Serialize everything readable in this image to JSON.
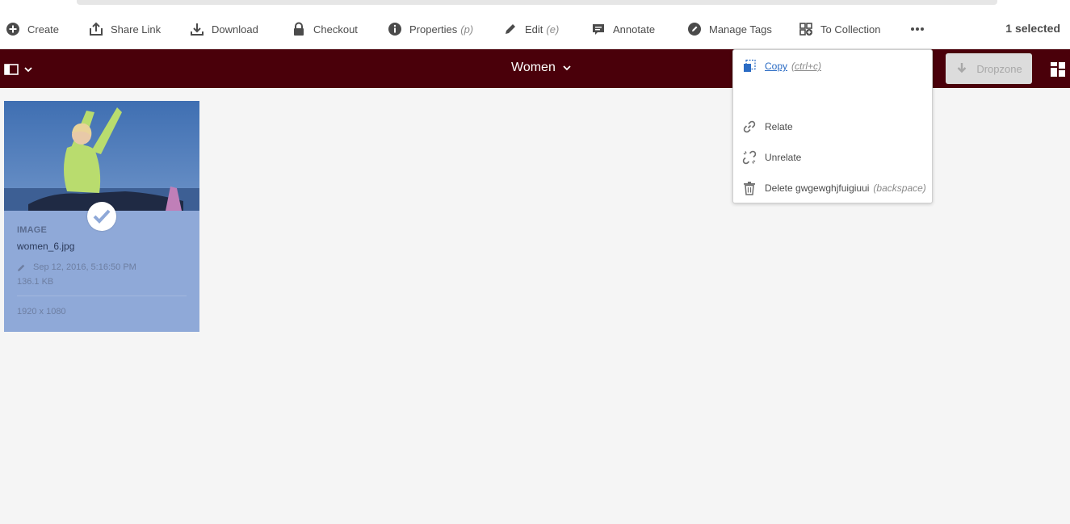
{
  "actionbar": {
    "actions": [
      {
        "label": "Create",
        "shortcut": "",
        "icon": "add-circle-icon"
      },
      {
        "label": "Share Link",
        "shortcut": "",
        "icon": "share-icon"
      },
      {
        "label": "Download",
        "shortcut": "",
        "icon": "download-icon"
      },
      {
        "label": "Checkout",
        "shortcut": "",
        "icon": "lock-icon"
      },
      {
        "label": "Properties",
        "shortcut": "(p)",
        "icon": "info-icon"
      },
      {
        "label": "Edit",
        "shortcut": "(e)",
        "icon": "pencil-icon"
      },
      {
        "label": "Annotate",
        "shortcut": "",
        "icon": "comment-icon"
      },
      {
        "label": "Manage Tags",
        "shortcut": "",
        "icon": "tag-icon"
      },
      {
        "label": "To Collection",
        "shortcut": "",
        "icon": "collection-add-icon"
      }
    ],
    "more_icon": "more-icon",
    "selection_count": "1 selected"
  },
  "header": {
    "folder_title": "Women",
    "dropzone_label": "Dropzone",
    "background": "#4a000a"
  },
  "card": {
    "type": "IMAGE",
    "filename": "women_6.jpg",
    "modified": "Sep 12, 2016, 5:16:50 PM",
    "size": "136.1 KB",
    "dimensions": "1920 x 1080",
    "selected": true,
    "selection_color": "#8fa9d8"
  },
  "popover": {
    "items": [
      {
        "label": "Copy",
        "shortcut": "(ctrl+c)",
        "icon": "copy-icon"
      },
      {
        "label": "Relate",
        "shortcut": "",
        "icon": "link-icon"
      },
      {
        "label": "Unrelate",
        "shortcut": "",
        "icon": "unlink-icon"
      },
      {
        "label": "Delete gwgewghjfuigiuui",
        "shortcut": "(backspace)",
        "icon": "trash-icon"
      }
    ]
  },
  "colors": {
    "accent_link": "#2a6bc4",
    "text": "#4b4b4b"
  }
}
